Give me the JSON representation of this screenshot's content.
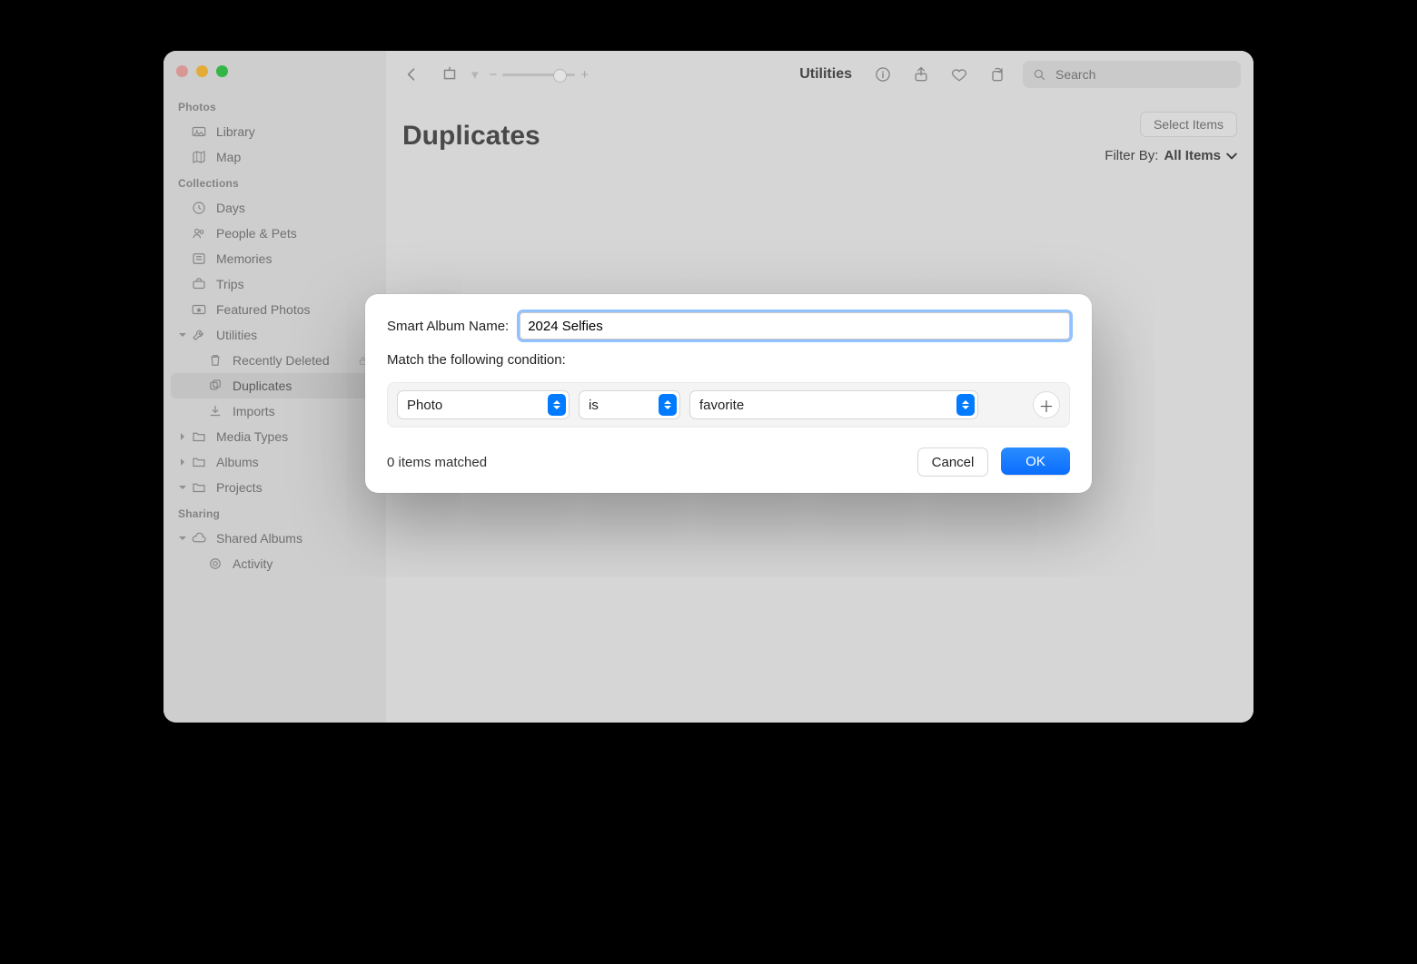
{
  "toolbar": {
    "title_label": "Utilities",
    "search_placeholder": "Search"
  },
  "page": {
    "title": "Duplicates",
    "select_items_label": "Select Items",
    "filter_by_label": "Filter By:",
    "filter_by_value": "All Items"
  },
  "sidebar": {
    "sections": {
      "photos": {
        "header": "Photos",
        "library": "Library",
        "map": "Map"
      },
      "collections": {
        "header": "Collections",
        "days": "Days",
        "people_pets": "People & Pets",
        "memories": "Memories",
        "trips": "Trips",
        "featured": "Featured Photos",
        "utilities": "Utilities",
        "recently_deleted": "Recently Deleted",
        "duplicates": "Duplicates",
        "imports": "Imports",
        "media_types": "Media Types",
        "albums": "Albums",
        "projects": "Projects"
      },
      "sharing": {
        "header": "Sharing",
        "shared_albums": "Shared Albums",
        "activity": "Activity"
      }
    }
  },
  "sheet": {
    "name_label": "Smart Album Name:",
    "name_value": "2024 Selfies",
    "condition_label": "Match the following condition:",
    "cond_field": "Photo",
    "cond_op": "is",
    "cond_value": "favorite",
    "matched_label": "0 items matched",
    "cancel_label": "Cancel",
    "ok_label": "OK"
  }
}
